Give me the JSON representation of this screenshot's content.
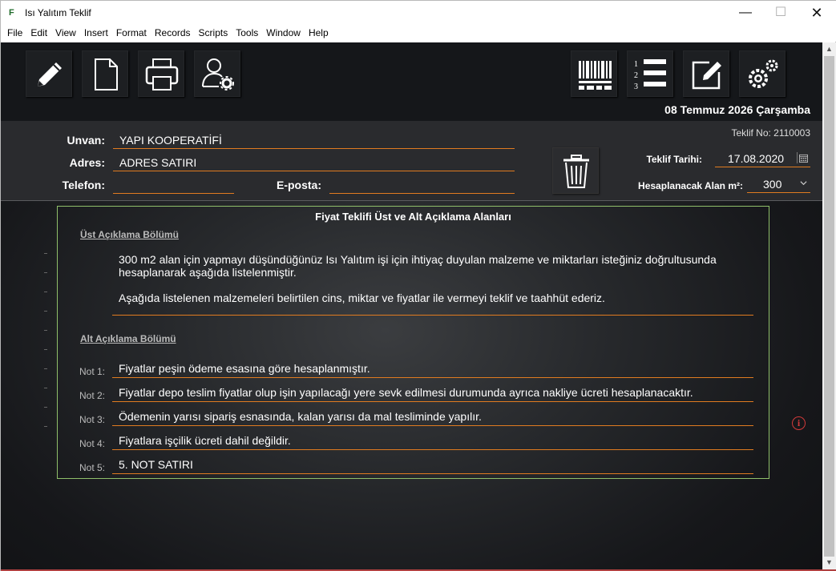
{
  "window": {
    "title": "Isı Yalıtım Teklif",
    "app_icon": "F",
    "minimize": "—",
    "maximize": "☐",
    "close": "✕"
  },
  "menu": [
    "File",
    "Edit",
    "View",
    "Insert",
    "Format",
    "Records",
    "Scripts",
    "Tools",
    "Window",
    "Help"
  ],
  "toolbar": {
    "left_icons": [
      "pencil-icon",
      "new-document-icon",
      "printer-icon",
      "user-settings-icon"
    ],
    "right_icons": [
      "barcode-icon",
      "numbered-list-icon",
      "edit-note-icon",
      "gear-icon"
    ]
  },
  "header": {
    "date": "08 Temmuz 2026 Çarşamba",
    "unvan_label": "Unvan:",
    "unvan_value": "YAPI KOOPERATİFİ",
    "adres_label": "Adres:",
    "adres_value": "ADRES SATIRI",
    "telefon_label": "Telefon:",
    "telefon_value": "",
    "eposta_label": "E-posta:",
    "eposta_value": "",
    "teklif_no": "Teklif No: 2110003",
    "teklif_tarihi_label": "Teklif Tarihi:",
    "teklif_tarihi_value": "17.08.2020",
    "alan_label": "Hesaplanacak Alan m²:",
    "alan_value": "300"
  },
  "panel": {
    "title": "Fiyat Teklifi Üst ve Alt Açıklama Alanları",
    "ust_title": "Üst Açıklama Bölümü",
    "ust_paragraph_1": "300 m2  alan için yapmayı düşündüğünüz  Isı Yalıtım işi için ihtiyaç duyulan malzeme ve miktarları isteğiniz doğrultusunda hesaplanarak  aşağıda listelenmiştir.",
    "ust_paragraph_2": "Aşağıda listelenen malzemeleri belirtilen cins, miktar ve fiyatlar ile vermeyi teklif ve taahhüt ederiz.",
    "alt_title": "Alt Açıklama Bölümü",
    "notes": [
      {
        "label": "Not 1:",
        "value": "Fiyatlar peşin ödeme esasına göre hesaplanmıştır."
      },
      {
        "label": "Not 2:",
        "value": "Fiyatlar depo teslim fiyatlar olup işin yapılacağı yere sevk edilmesi durumunda ayrıca nakliye ücreti hesaplanacaktır."
      },
      {
        "label": "Not 3:",
        "value": "Ödemenin yarısı sipariş esnasında, kalan yarısı da mal tesliminde yapılır."
      },
      {
        "label": "Not 4:",
        "value": "Fiyatlara işçilik ücreti dahil değildir."
      },
      {
        "label": "Not 5:",
        "value": "5. NOT SATIRI"
      }
    ]
  },
  "info_icon": "i"
}
